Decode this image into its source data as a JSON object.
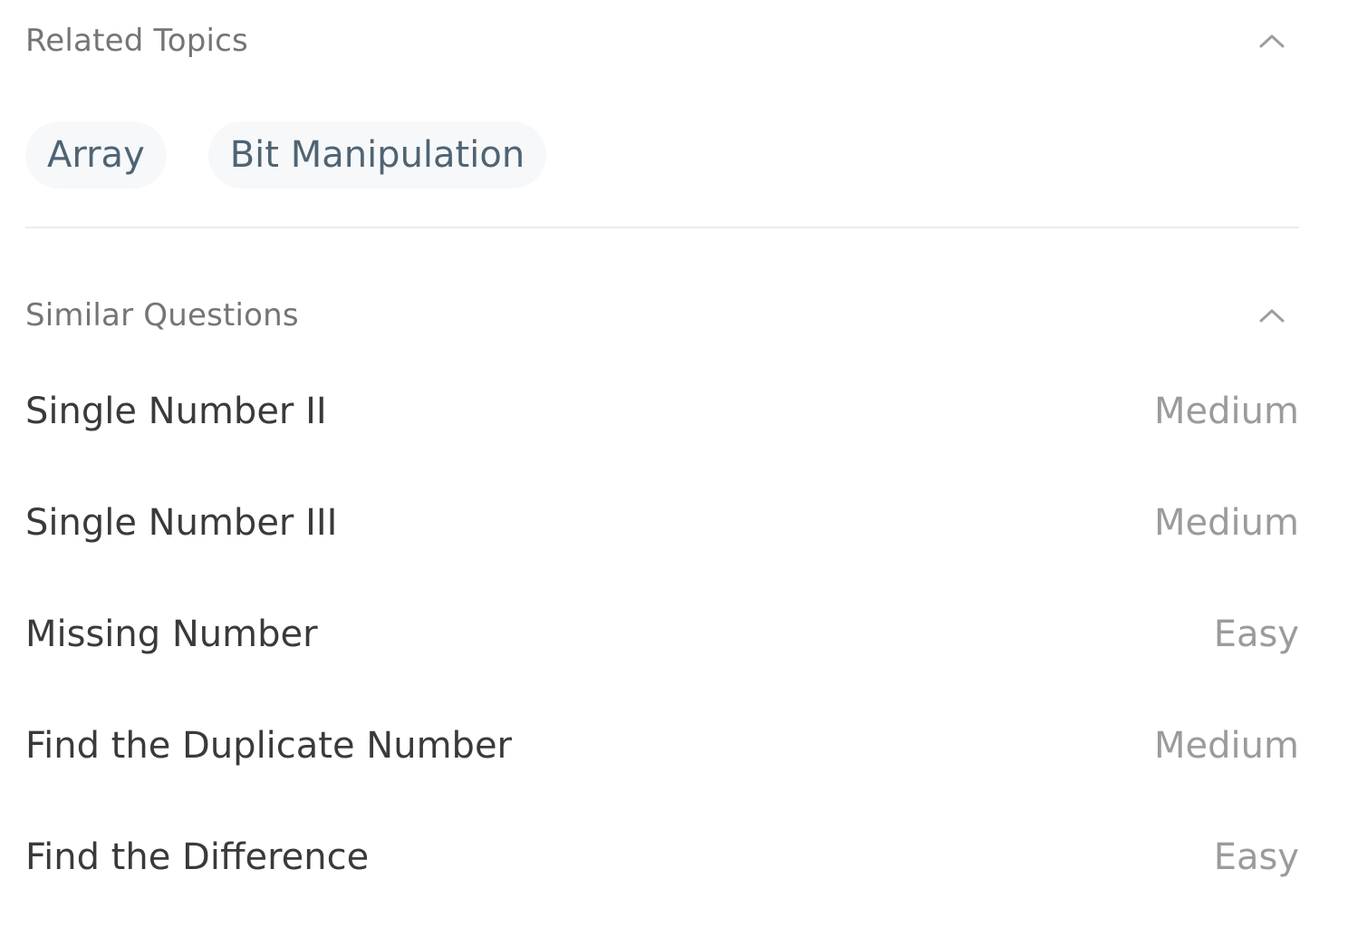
{
  "related_topics": {
    "title": "Related Topics",
    "toggle_icon": "chevron-up-icon",
    "tags": [
      {
        "label": "Array"
      },
      {
        "label": "Bit Manipulation"
      }
    ]
  },
  "similar_questions": {
    "title": "Similar Questions",
    "toggle_icon": "chevron-up-icon",
    "items": [
      {
        "title": "Single Number II",
        "difficulty": "Medium"
      },
      {
        "title": "Single Number III",
        "difficulty": "Medium"
      },
      {
        "title": "Missing Number",
        "difficulty": "Easy"
      },
      {
        "title": "Find the Duplicate Number",
        "difficulty": "Medium"
      },
      {
        "title": "Find the Difference",
        "difficulty": "Easy"
      }
    ]
  },
  "colors": {
    "section_title": "#757575",
    "tag_background": "#f7f8fa",
    "tag_text": "#4f6473",
    "question_title": "#3a3a3a",
    "difficulty_text": "#9b9b9b",
    "divider": "#ececec"
  }
}
